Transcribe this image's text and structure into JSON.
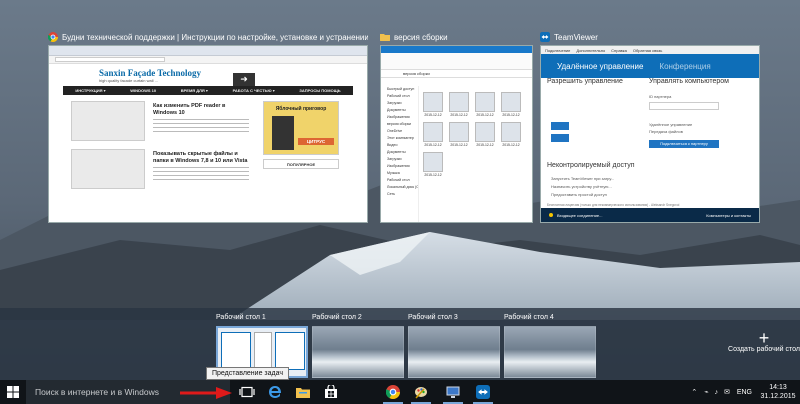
{
  "windows": [
    {
      "title": "Будни технической поддержки | Инструкции по настройке, установке и устранении пр...",
      "icon": "chrome-icon",
      "site_title": "Sanxin Façade Technology",
      "site_subtitle": "high quality facade curtain wall ...",
      "nav": [
        "ИНСТРУКЦИЯ ▾",
        "WINDOWS 10",
        "ВРЕМЯ ДЛЯ ▾",
        "РАБОТА С ЧЕСТЬЮ ▾",
        "ЗАПРОСЫ ПОМОЩЬ"
      ],
      "articles": [
        "Как изменить PDF reader в Windows 10",
        "Показывать скрытые файлы и папки в Windows 7,8 и 10 или Vista"
      ],
      "ad_title": "Яблочный приговор",
      "ad_brand": "ЦИТРУС",
      "popular_label": "ПОПУЛЯРНОЕ"
    },
    {
      "title": "версия сборки",
      "icon": "folder-icon",
      "address": "версия сборки",
      "nav_items": [
        "Быстрый доступ",
        "Рабочий стол",
        "Загрузки",
        "Документы",
        "Изображения",
        "версия сборки",
        "OneDrive",
        "Этот компьютер",
        "Видео",
        "Документы",
        "Загрузки",
        "Изображения",
        "Музыка",
        "Рабочий стол",
        "Локальный диск (C:)",
        "Сеть"
      ],
      "files": [
        "2015-12-12",
        "2015-12-12",
        "2015-12-12",
        "2015-12-12",
        "2015-12-12",
        "2015-12-12",
        "2015-12-12",
        "2015-12-12",
        "2015-12-12"
      ]
    },
    {
      "title": "TeamViewer",
      "icon": "teamviewer-icon",
      "menu": [
        "Подключение",
        "Дополнительно",
        "Справка",
        "Обратная связь"
      ],
      "tab_remote": "Удалённое управление",
      "tab_meeting": "Конференция",
      "allow_title": "Разрешить управление",
      "control_title": "Управлять компьютером",
      "partner_id_label": "ID партнера",
      "radio_remote": "Удалённое управление",
      "radio_files": "Передача файлов",
      "connect_button": "Подключиться к партнеру",
      "unattended_title": "Неконтролируемый доступ",
      "unattended_lines": [
        "Запустить TeamViewer при загру...",
        "Назначить устройству учётную...",
        "Предоставить простой доступ"
      ],
      "status_text": "Входящее соединение...",
      "contacts_label": "Компьютеры и контакты",
      "footer_text": "Бесплатная лицензия (только для некоммерческого использования) - Aleksandr Snegovoi"
    }
  ],
  "desktops": [
    "Рабочий стол 1",
    "Рабочий стол 2",
    "Рабочий стол 3",
    "Рабочий стол 4"
  ],
  "new_desktop_label": "Создать рабочий стол",
  "tooltip": "Представление задач",
  "taskbar": {
    "search_placeholder": "Поиск в интернете и в Windows",
    "apps": [
      "task-view-icon",
      "edge-icon",
      "file-explorer-icon",
      "store-icon",
      "chrome-icon",
      "paint-icon",
      "remote-icon",
      "teamviewer-icon"
    ],
    "language": "ENG",
    "time": "14:13",
    "date": "31.12.2015"
  },
  "colors": {
    "accent": "#0e6eb8",
    "taskbar": "#101418",
    "arrow": "#e01a1a"
  }
}
